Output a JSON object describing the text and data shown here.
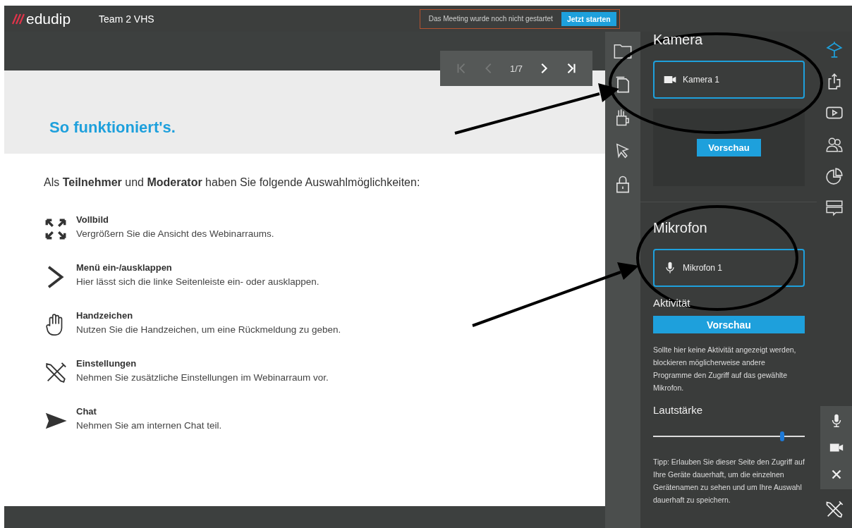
{
  "header": {
    "logo": "edudip",
    "title": "Team 2 VHS",
    "notice": "Das Meeting wurde noch nicht gestartet",
    "start_button": "Jetzt starten"
  },
  "pager": {
    "page": "1/7",
    "buttons": [
      {
        "kind": "first",
        "disabled": true
      },
      {
        "kind": "prev",
        "disabled": true
      },
      {
        "kind": "next",
        "disabled": false
      },
      {
        "kind": "last",
        "disabled": false
      }
    ]
  },
  "slide": {
    "heading": "So funktioniert's.",
    "intro": "Als **Teilnehmer** und **Moderator** haben Sie folgende Auswahlmöglichkeiten:",
    "features": [
      {
        "kind": "fullscreen",
        "title": "Vollbild",
        "text": "Vergrößern Sie die Ansicht des Webinarraums."
      },
      {
        "kind": "chevron",
        "title": "Menü ein-/ausklappen",
        "text": "Hier lässt sich die linke Seitenleiste ein- oder ausklappen."
      },
      {
        "kind": "hand",
        "title": "Handzeichen",
        "text": "Nutzen Sie die Handzeichen, um eine Rückmeldung zu geben."
      },
      {
        "kind": "tools",
        "title": "Einstellungen",
        "text": "Nehmen Sie zusätzliche Einstellungen im Webinarraum vor."
      },
      {
        "kind": "send",
        "title": "Chat",
        "text": "Nehmen Sie am internen Chat teil."
      }
    ]
  },
  "toolbar": [
    {
      "kind": "folder",
      "selected": false
    },
    {
      "kind": "document",
      "selected": false
    },
    {
      "kind": "pencils",
      "selected": false
    },
    {
      "kind": "pointer",
      "selected": false
    },
    {
      "kind": "lock",
      "selected": false
    }
  ],
  "rail": [
    {
      "kind": "presentation",
      "selected": true
    },
    {
      "kind": "share",
      "selected": false
    },
    {
      "kind": "video",
      "selected": false
    },
    {
      "kind": "people",
      "selected": false
    },
    {
      "kind": "poll",
      "selected": false
    },
    {
      "kind": "chat",
      "selected": false
    }
  ],
  "camera": {
    "heading": "Kamera",
    "device": "Kamera 1",
    "preview_button": "Vorschau"
  },
  "microphone": {
    "heading": "Mikrofon",
    "device": "Mikrofon 1",
    "activity_label": "Aktivität",
    "preview_button": "Vorschau",
    "hint": "Sollte hier keine Aktivität angezeigt werden, blockieren möglicherweise andere Programme den Zugriff auf das gewählte Mikrofon.",
    "volume_label": "Lautstärke",
    "volume": {
      "level": 0.85
    },
    "tip": "Tipp: Erlauben Sie dieser Seite den Zugriff auf Ihre Geräte dauerhaft, um die einzelnen Gerätenamen zu sehen und um Ihre Auswahl dauerhaft zu speichern."
  },
  "media_controls": [
    {
      "kind": "mic"
    },
    {
      "kind": "camera"
    },
    {
      "kind": "close"
    }
  ]
}
